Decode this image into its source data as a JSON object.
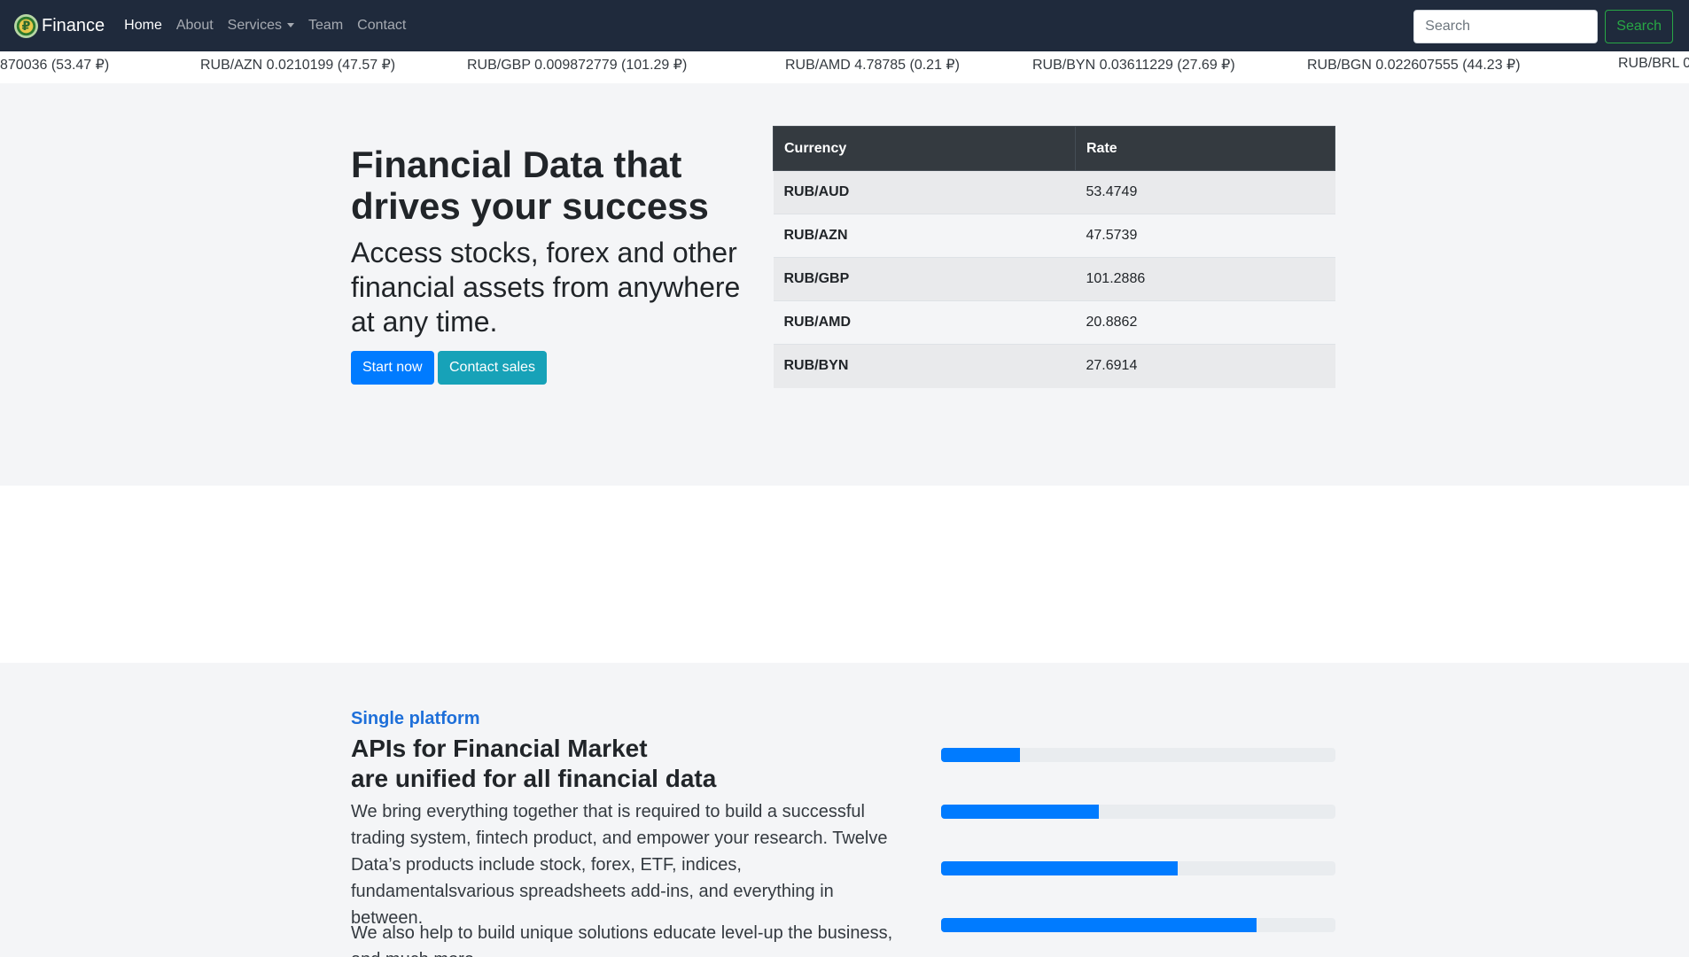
{
  "navbar": {
    "brand": "Finance",
    "logo_glyph": "₽",
    "links": [
      {
        "label": "Home",
        "active": true
      },
      {
        "label": "About",
        "active": false
      },
      {
        "label": "Services",
        "active": false,
        "dropdown": true
      },
      {
        "label": "Team",
        "active": false
      },
      {
        "label": "Contact",
        "active": false
      }
    ],
    "search_placeholder": "Search",
    "search_button": "Search"
  },
  "ticker": [
    "870036 (53.47 ₽)",
    "RUB/AZN 0.0210199 (47.57 ₽)",
    "RUB/GBP 0.009872779 (101.29 ₽)",
    "RUB/AMD 4.78785 (0.21 ₽)",
    "RUB/BYN 0.03611229 (27.69 ₽)",
    "RUB/BGN 0.022607555 (44.23 ₽)",
    "RUB/BRL 0"
  ],
  "hero": {
    "title": "Financial Data that drives your success",
    "lead": "Access stocks, forex and other financial assets from anywhere at any time.",
    "primary_button": "Start now",
    "secondary_button": "Contact sales"
  },
  "rates_table": {
    "headers": [
      "Currency",
      "Rate"
    ],
    "rows": [
      {
        "currency": "RUB/AUD",
        "rate": "53.4749"
      },
      {
        "currency": "RUB/AZN",
        "rate": "47.5739"
      },
      {
        "currency": "RUB/GBP",
        "rate": "101.2886"
      },
      {
        "currency": "RUB/AMD",
        "rate": "20.8862"
      },
      {
        "currency": "RUB/BYN",
        "rate": "27.6914"
      }
    ]
  },
  "features": {
    "eyebrow": "Single platform",
    "title_line1": "APIs for Financial Market",
    "title_line2": "are unified for all financial data",
    "paragraph1": "We bring everything together that is required to build a successful trading system, fintech product, and empower your research. Twelve Data’s products include stock, forex, ETF, indices, fundamentalsvarious spreadsheets add-ins, and everything in between.",
    "paragraph2": "We also help to build unique solutions educate level-up the business, and much more.",
    "progress": [
      20,
      40,
      60,
      80
    ]
  },
  "colors": {
    "navbar": "#1f2a3c",
    "primary": "#007bff",
    "info": "#17a2b8",
    "success": "#28a745",
    "accent_text": "#1e6fd9"
  }
}
